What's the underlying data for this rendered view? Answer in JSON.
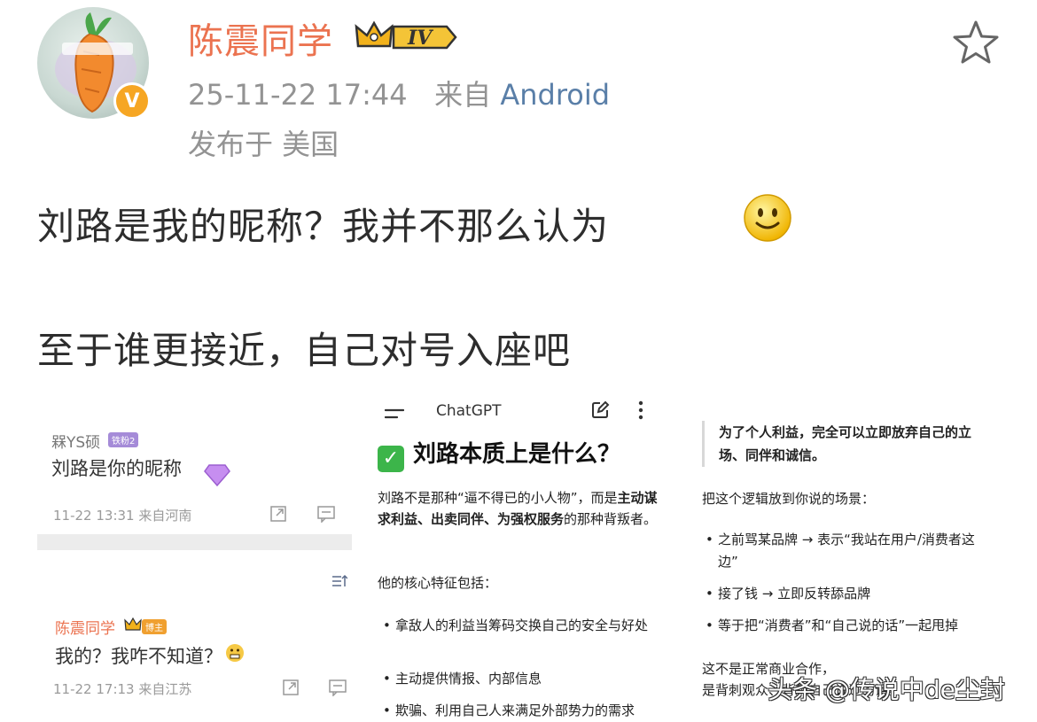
{
  "post": {
    "username": "陈震同学",
    "level_badge": "IV",
    "timestamp": "25-11-22 17:44",
    "source_prefix": "来自",
    "source": "Android",
    "location": "发布于 美国",
    "verified_badge": "V",
    "text_line1": "刘路是我的昵称？我并不那么认为",
    "text_line2": "至于谁更接近，自己对号入座吧"
  },
  "image1": {
    "comment1": {
      "name": "槑YS硕",
      "tag": "铁粉2",
      "text": "刘路是你的昵称",
      "meta": "11-22 13:31  来自河南"
    },
    "comment2": {
      "name": "陈震同学",
      "tag": "博主",
      "text": "我的？我咋不知道？",
      "meta": "11-22 17:13  来自江苏"
    }
  },
  "image2": {
    "title": "ChatGPT",
    "heading": "刘路本质上是什么？",
    "check_mark": "✓",
    "para1_a": "刘路不是那种“逼不得已的小人物”，而是",
    "para1_b": "主动谋求利益、出卖同伴、为强权服务",
    "para1_c": "的那种背叛者。",
    "para2": "他的核心特征包括：",
    "bullets": [
      "拿敌人的利益当筹码交换自己的安全与好处",
      "主动提供情报、内部信息",
      "欺骗、利用自己人来满足外部势力的需求"
    ]
  },
  "image3": {
    "quote": "为了个人利益，完全可以立即放弃自己的立场、同伴和诚信。",
    "intro": "把这个逻辑放到你说的场景：",
    "bullets": [
      "之前骂某品牌 → 表示“我站在用户/消费者这边”",
      "接了钱 → 立即反转舔品牌",
      "等于把“消费者”和“自己说的话”一起甩掉"
    ],
    "closing_line1": "这不是正常商业合作，",
    "closing_line2": "是背刺观众、背刺自己说过的话。"
  },
  "watermark": "头条 @传说中de尘封",
  "colors": {
    "username": "#eb7350",
    "source_link": "#5a7fa8",
    "meta_gray": "#939393",
    "check_green": "#3cb54a"
  }
}
